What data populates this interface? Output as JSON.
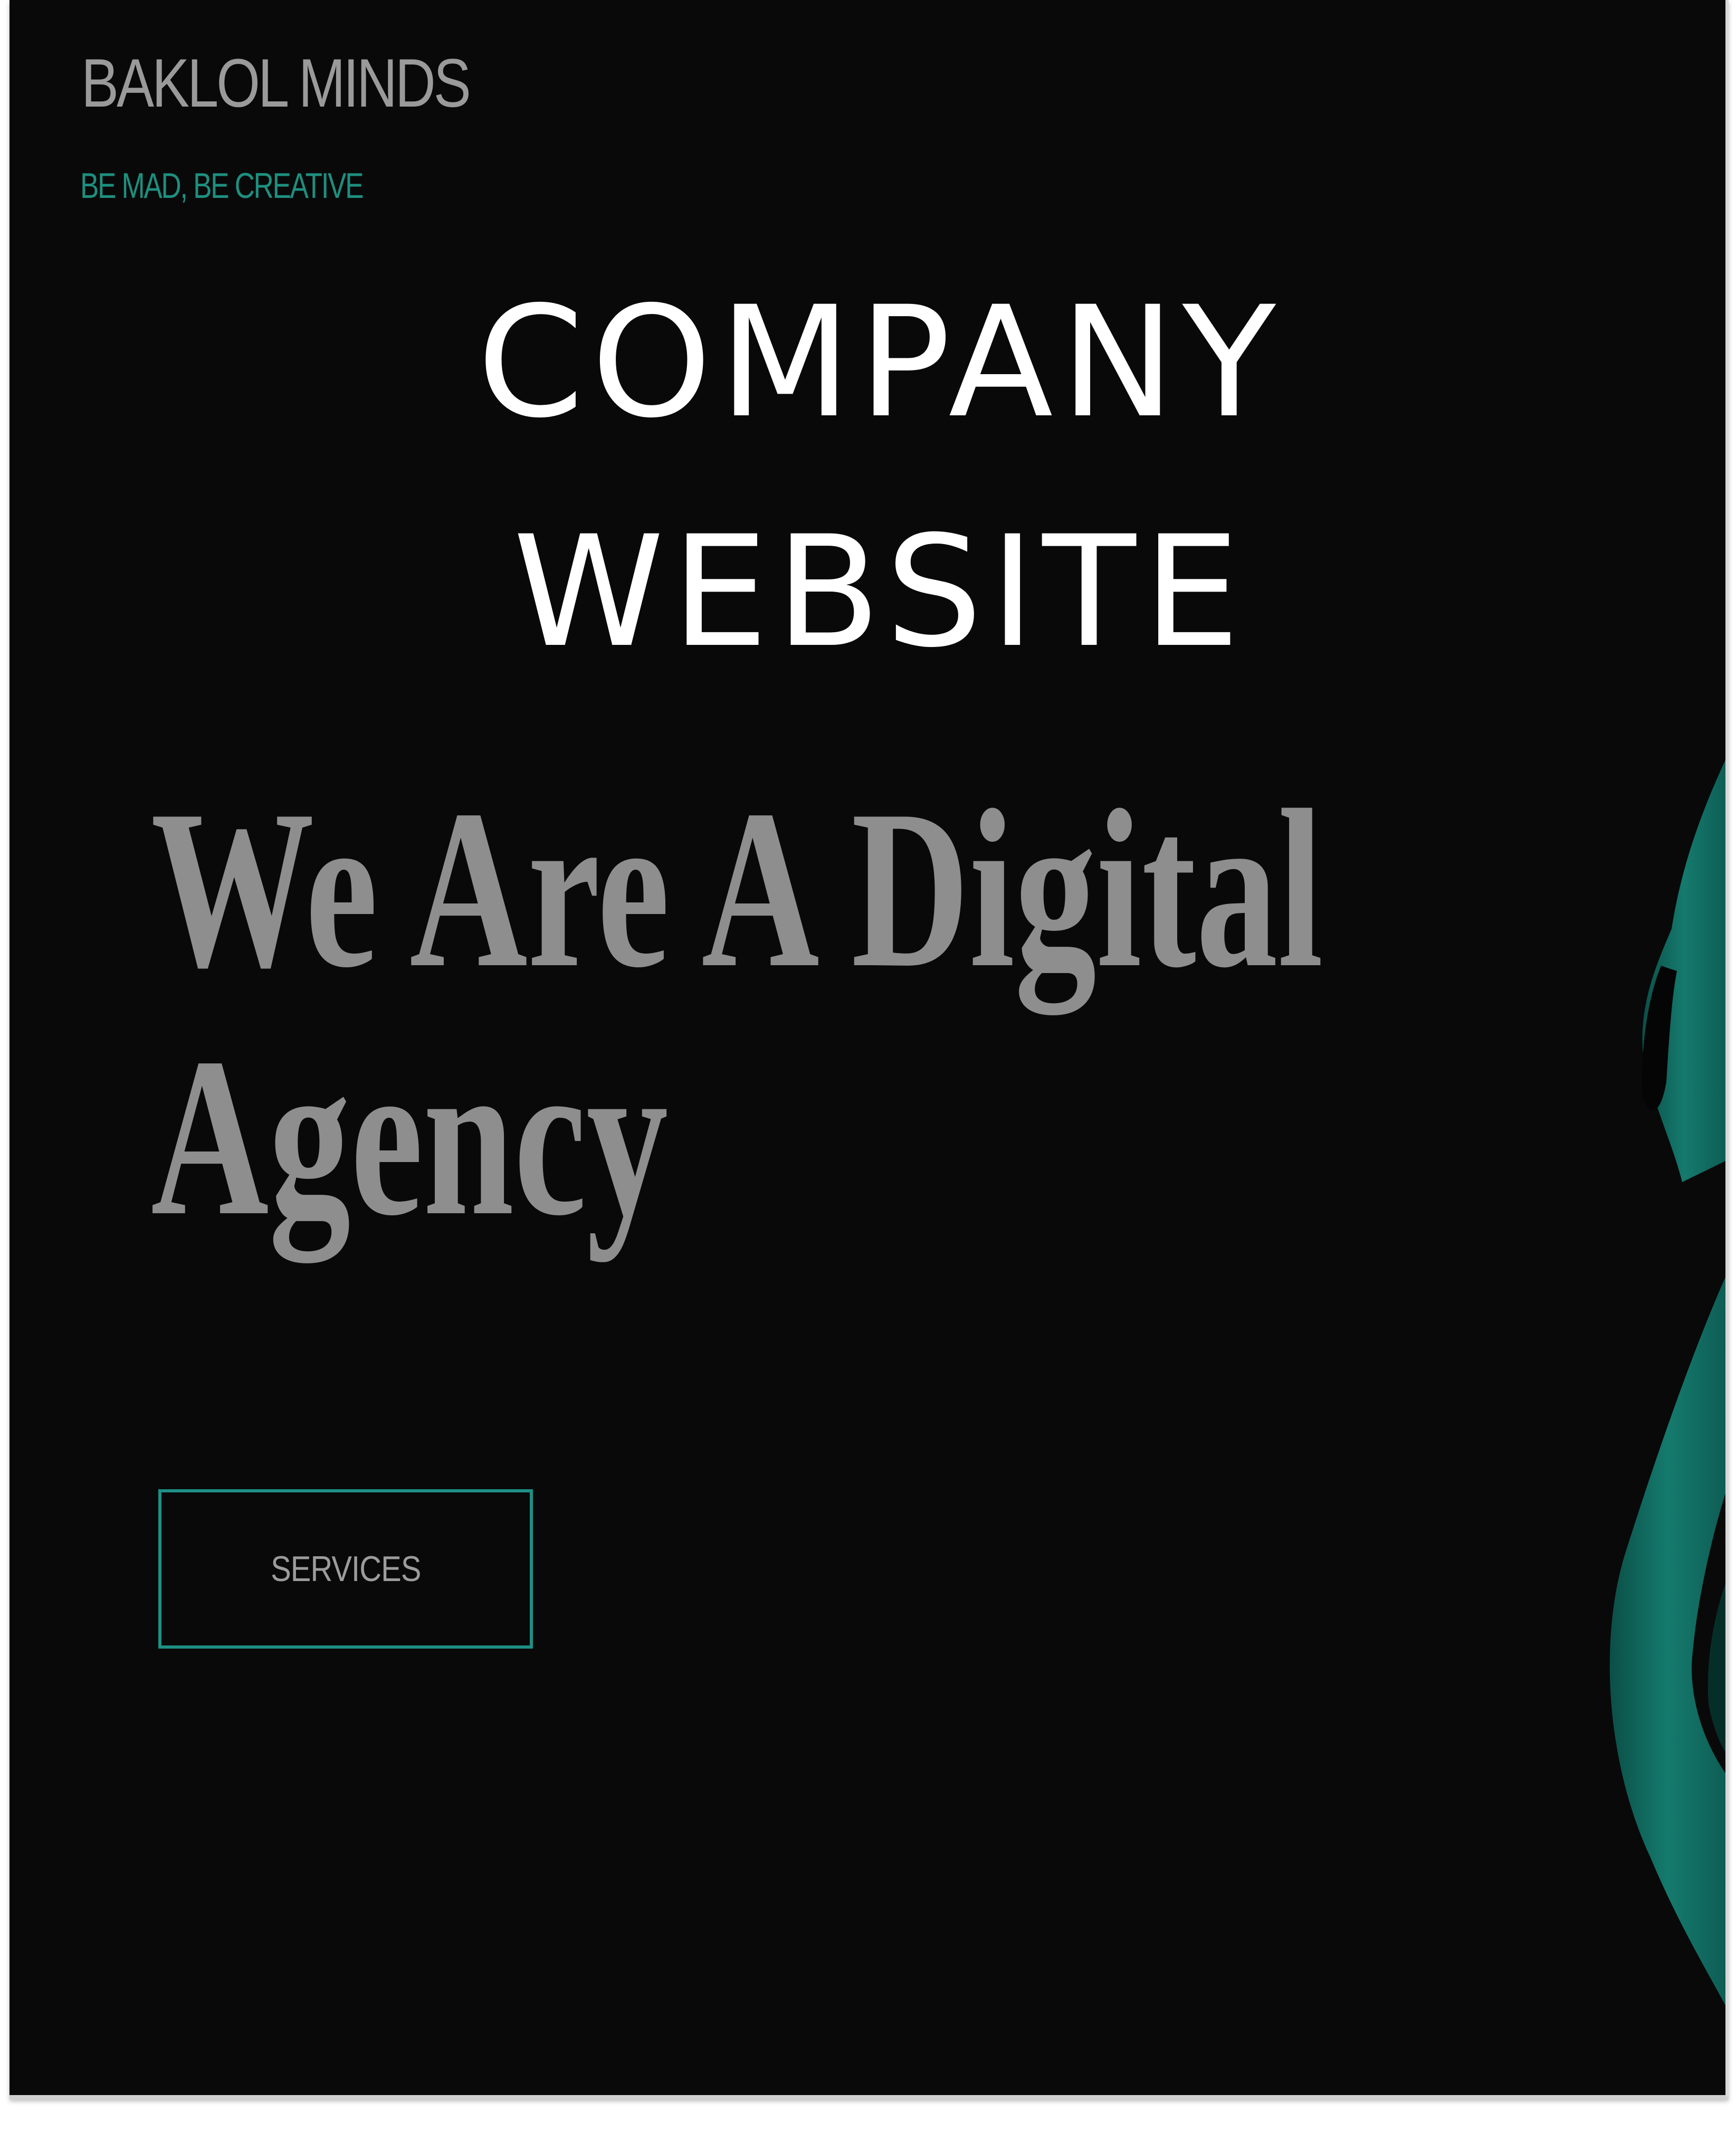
{
  "header": {
    "brand_name": "BAKLOL MINDS",
    "tagline": "BE MAD, BE CREATIVE"
  },
  "overlay": {
    "title_line1": "COMPANY",
    "title_line2": "WEBSITE"
  },
  "hero": {
    "heading_line1": "We Are A Digital",
    "heading_line2": "Agency",
    "cta_label": "SERVICES"
  },
  "colors": {
    "background": "#090909",
    "accent_teal": "#1e8f85",
    "brand_gray": "#9a9a9a",
    "heading_gray": "#8e8e8e",
    "overlay_white": "#ffffff"
  },
  "icons": {
    "hero_image": "flamingo-illustration"
  }
}
